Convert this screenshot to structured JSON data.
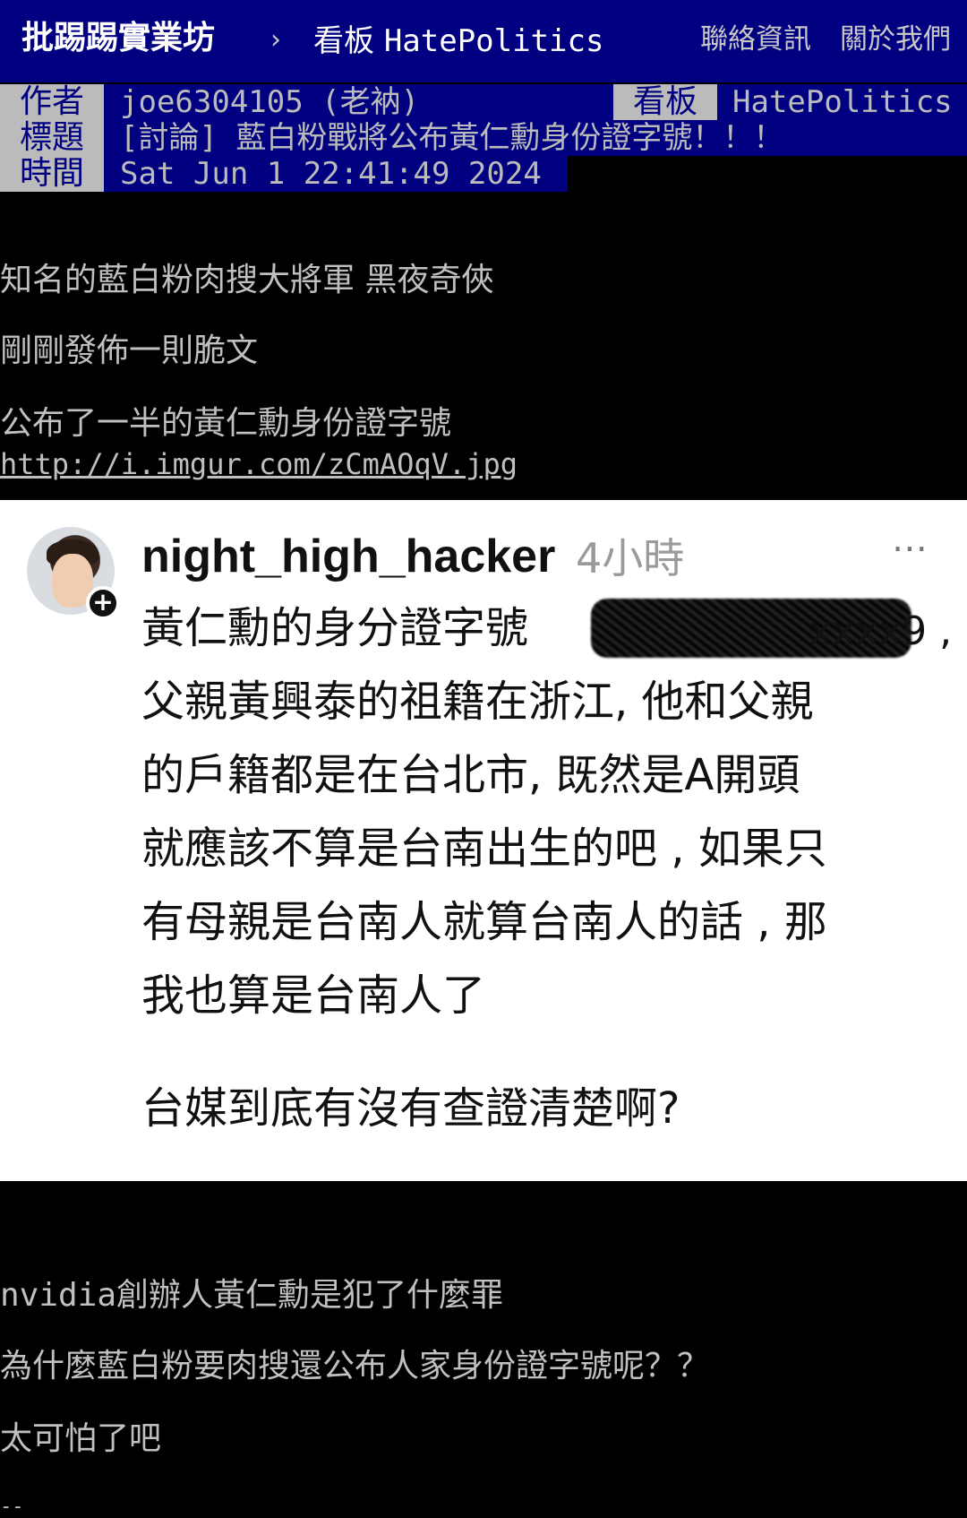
{
  "topbar": {
    "brand": "批踢踢實業坊",
    "separator": "›",
    "board_prefix": "看板",
    "board_name": "HatePolitics",
    "nav_contact": "聯絡資訊",
    "nav_about": "關於我們"
  },
  "header": {
    "author_label": "作者",
    "author_value": "joe6304105 (老衲)",
    "board_label": "看板",
    "board_value": "HatePolitics",
    "title_label": "標題",
    "title_value": "[討論] 藍白粉戰將公布黃仁勳身份證字號！！！",
    "time_label": "時間",
    "time_value": "Sat Jun  1 22:41:49 2024"
  },
  "body": {
    "lines": [
      "知名的藍白粉肉搜大將軍  黑夜奇俠",
      "剛剛發佈一則脆文",
      "公布了一半的黃仁勳身份證字號"
    ],
    "image_link": "http://i.imgur.com/zCmAOqV.jpg"
  },
  "embed": {
    "username": "night_high_hacker",
    "time_ago": "4小時",
    "more_icon": "⋯",
    "follow_icon": "+",
    "text_lines": [
      "黃仁勳的身分證字號",
      "父親黃興泰的祖籍在浙江, 他和父親",
      "的戶籍都是在台北市, 既然是A開頭",
      "就應該不算是台南出生的吧 , 如果只",
      "有母親是台南人就算台南人的話 , 那",
      "我也算是台南人了"
    ],
    "redacted_tail": "xxxx9 ,",
    "question": "台媒到底有沒有查證清楚啊?"
  },
  "tail": {
    "line1_prefix": "nvidia",
    "line1_rest": "創辦人黃仁勳是犯了什麼罪",
    "line2": "為什麼藍白粉要肉搜還公布人家身份證字號呢？？",
    "line3": "太可怕了吧",
    "cursor": "--"
  }
}
